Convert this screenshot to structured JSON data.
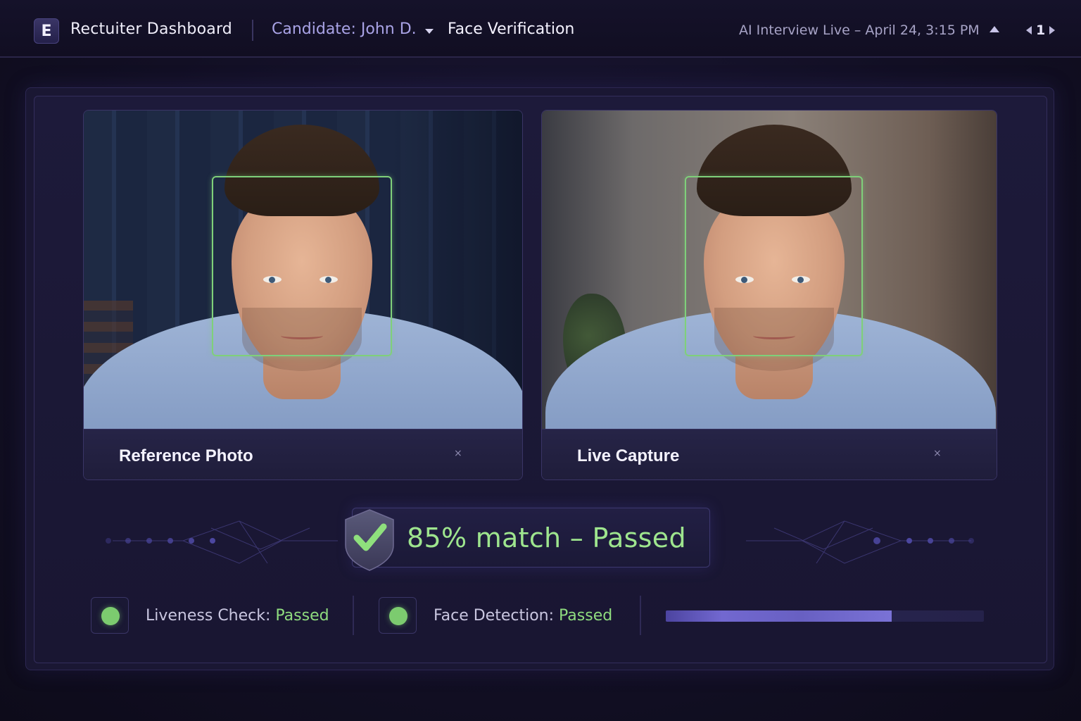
{
  "header": {
    "logo_letter": "E",
    "app_title": "Rectuiter Dashboard",
    "candidate": "Candidate: John D.",
    "page_name": "Face Verification",
    "live_status": "AI Interview Live – April 24, 3:15 PM",
    "page_number": "1"
  },
  "cards": {
    "reference": {
      "caption": "Reference Photo",
      "close_glyph": "×"
    },
    "live": {
      "caption": "Live Capture",
      "close_glyph": "×"
    }
  },
  "result": {
    "match_text": "85% match – Passed",
    "match_percent": 85
  },
  "checks": {
    "liveness_label": "Liveness Check: ",
    "liveness_value": "Passed",
    "face_detection_label": "Face Detection: ",
    "face_detection_value": "Passed"
  },
  "progress": {
    "fraction": 0.71
  },
  "colors": {
    "accent_green": "#9ee58e",
    "status_green": "#7ccb6f",
    "face_box_green": "#7fd07a",
    "accent_purple": "#a9a3e6"
  },
  "icons": {
    "logo": "brand-logo-icon",
    "dropdown": "chevron-down-icon",
    "status_collapse": "chevron-up-icon",
    "prev": "arrow-left-icon",
    "next": "arrow-right-icon",
    "shield": "shield-check-icon",
    "status": "status-dot-icon"
  }
}
